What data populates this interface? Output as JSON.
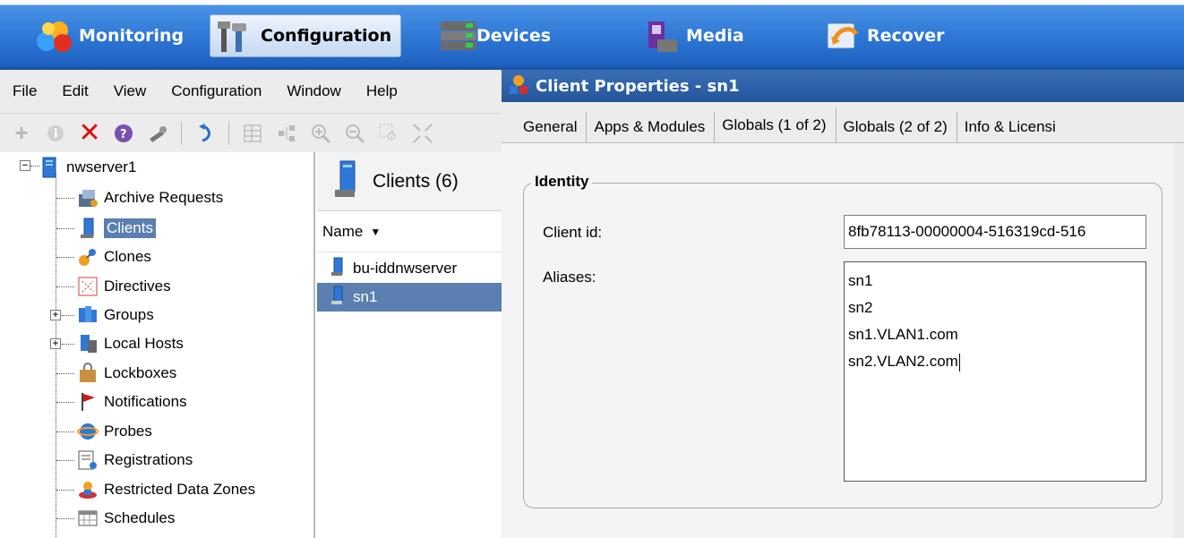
{
  "topnav": {
    "items": [
      {
        "label": "Monitoring",
        "icon": "monitoring-icon"
      },
      {
        "label": "Configuration",
        "icon": "configuration-icon"
      },
      {
        "label": "Devices",
        "icon": "devices-icon"
      },
      {
        "label": "Media",
        "icon": "media-icon"
      },
      {
        "label": "Recover",
        "icon": "recover-icon"
      }
    ],
    "active": "Configuration"
  },
  "menubar": {
    "items": [
      "File",
      "Edit",
      "View",
      "Configuration",
      "Window",
      "Help"
    ]
  },
  "toolbar": {
    "icons": [
      "add-icon",
      "info-icon",
      "delete-icon",
      "help-icon",
      "wrench-icon",
      "refresh-icon",
      "table-icon",
      "tree-layout-icon",
      "zoom-in-icon",
      "zoom-out-icon",
      "zoom-select-icon",
      "fit-icon"
    ]
  },
  "tree": {
    "root": "nwserver1",
    "items": [
      {
        "label": "Archive Requests"
      },
      {
        "label": "Clients"
      },
      {
        "label": "Clones"
      },
      {
        "label": "Directives"
      },
      {
        "label": "Groups"
      },
      {
        "label": "Local Hosts"
      },
      {
        "label": "Lockboxes"
      },
      {
        "label": "Notifications"
      },
      {
        "label": "Probes"
      },
      {
        "label": "Registrations"
      },
      {
        "label": "Restricted Data Zones"
      },
      {
        "label": "Schedules"
      }
    ],
    "selected": "Clients"
  },
  "clients": {
    "title": "Clients (6)",
    "column": "Name",
    "rows": [
      "bu-iddnwserver",
      "sn1"
    ],
    "selected": "sn1"
  },
  "dialog": {
    "title": "Client Properties - sn1",
    "tabs": [
      "General",
      "Apps & Modules",
      "Globals (1 of 2)",
      "Globals (2 of 2)",
      "Info & Licensi"
    ],
    "active_tab": "Globals (1 of 2)",
    "identity": {
      "legend": "Identity",
      "client_id_label": "Client id:",
      "client_id_value": "8fb78113-00000004-516319cd-516",
      "aliases_label": "Aliases:",
      "aliases": [
        "sn1",
        "sn2",
        "sn1.VLAN1.com",
        "sn2.VLAN2.com"
      ]
    }
  },
  "colors": {
    "nav_blue": "#2f78d6",
    "title_blue": "#24559b",
    "selection": "#5a7fb0",
    "panel_bg": "#ececec"
  }
}
